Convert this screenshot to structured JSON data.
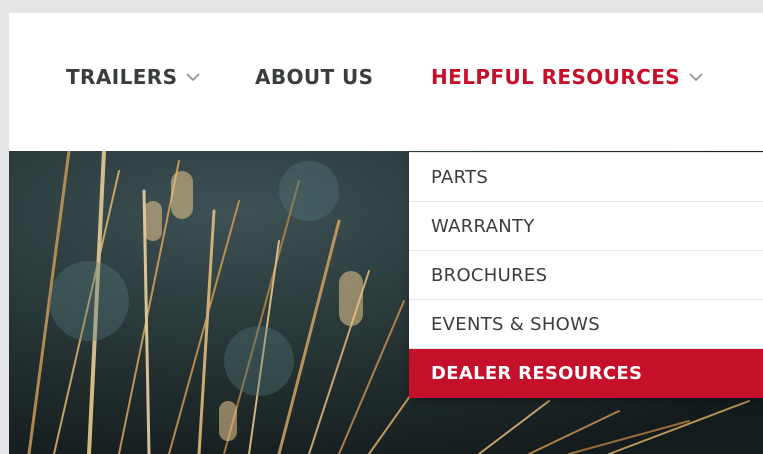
{
  "nav": {
    "items": [
      {
        "label": "TRAILERS",
        "has_dropdown": true,
        "active": false
      },
      {
        "label": "ABOUT US",
        "has_dropdown": false,
        "active": false
      },
      {
        "label": "HELPFUL RESOURCES",
        "has_dropdown": true,
        "active": true
      }
    ]
  },
  "dropdown": {
    "items": [
      {
        "label": "PARTS"
      },
      {
        "label": "WARRANTY"
      },
      {
        "label": "BROCHURES"
      },
      {
        "label": "EVENTS & SHOWS"
      },
      {
        "label": "DEALER RESOURCES",
        "highlighted": true
      }
    ]
  },
  "colors": {
    "accent": "#c5102c",
    "nav_text": "#3a3d40",
    "page_bg": "#e3e5e6",
    "hero_bg": "#1e2b2f"
  }
}
